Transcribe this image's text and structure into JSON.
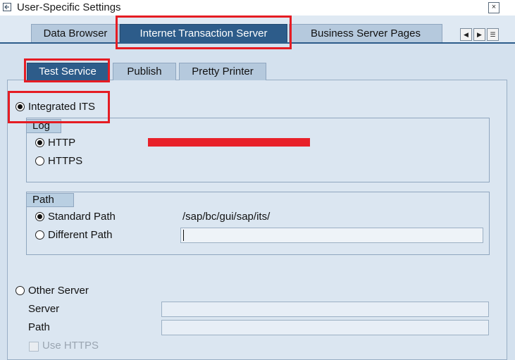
{
  "window": {
    "title": "User-Specific Settings",
    "close_symbol": "×"
  },
  "main_tabs": [
    {
      "label": "Data Browser",
      "active": false
    },
    {
      "label": "Internet Transaction Server",
      "active": true
    },
    {
      "label": "Business Server Pages",
      "active": false
    }
  ],
  "tab_scroll": {
    "left": "◀",
    "right": "▶",
    "list": "☰"
  },
  "sub_tabs": [
    {
      "label": "Test Service",
      "active": true
    },
    {
      "label": "Publish",
      "active": false
    },
    {
      "label": "Pretty Printer",
      "active": false
    }
  ],
  "integrated_its": {
    "label": "Integrated ITS",
    "selected": true,
    "log_group": {
      "title": "Log",
      "options": [
        {
          "label": "HTTP",
          "selected": true
        },
        {
          "label": "HTTPS",
          "selected": false
        }
      ]
    },
    "path_group": {
      "title": "Path",
      "options": [
        {
          "label": "Standard Path",
          "selected": true,
          "value": "/sap/bc/gui/sap/its/"
        },
        {
          "label": "Different Path",
          "selected": false,
          "value": ""
        }
      ]
    }
  },
  "other_server": {
    "label": "Other Server",
    "selected": false,
    "server_label": "Server",
    "server_value": "",
    "path_label": "Path",
    "path_value": "",
    "use_https_label": "Use HTTPS",
    "use_https_checked": false
  },
  "colors": {
    "active_tab": "#2d5c8a",
    "inactive_tab": "#b5c9dd",
    "panel": "#d4e1ee",
    "highlight": "#e51c23"
  }
}
